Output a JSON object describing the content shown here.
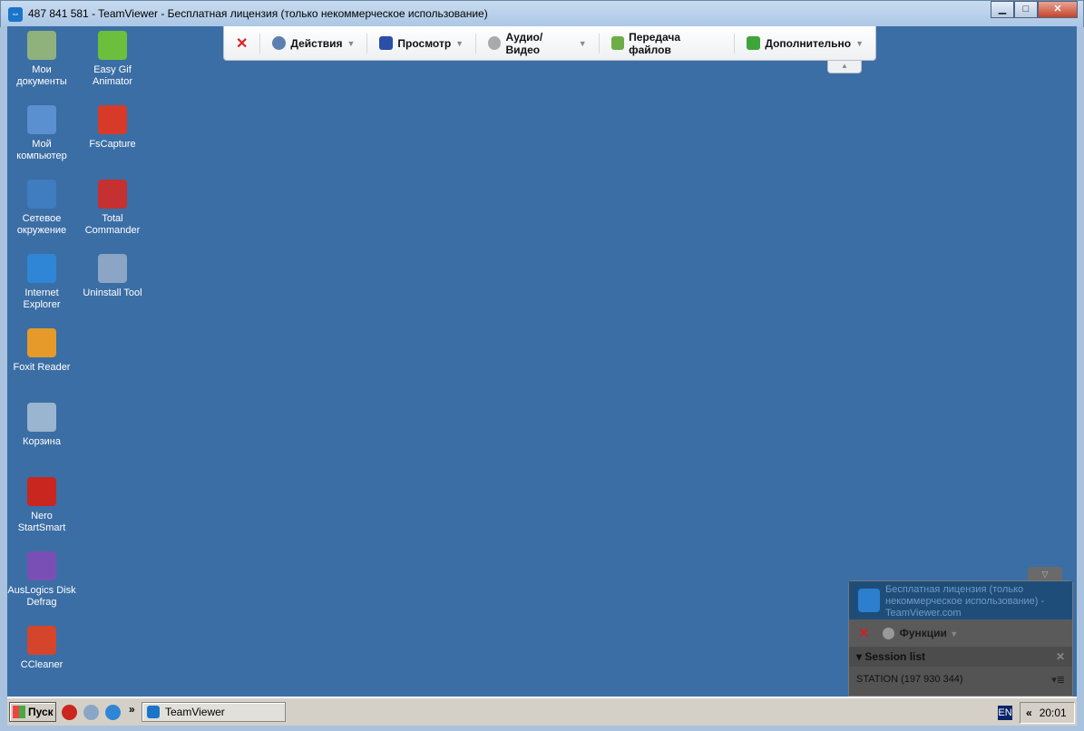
{
  "window": {
    "title": "487 841 581 - TeamViewer - Бесплатная лицензия (только некоммерческое использование)",
    "minimize": "▁",
    "maximize": "□",
    "close": "✕"
  },
  "toolbar": {
    "close_glyph": "✕",
    "items": [
      {
        "label": "Действия",
        "icon": "gear-icon"
      },
      {
        "label": "Просмотр",
        "icon": "monitor-icon"
      },
      {
        "label": "Аудио/Видео",
        "icon": "webcam-icon"
      },
      {
        "label": "Передача файлов",
        "icon": "file-transfer-icon"
      },
      {
        "label": "Дополнительно",
        "icon": "puzzle-icon"
      }
    ],
    "caret": "▼",
    "collapse": "▲"
  },
  "desktop_icons": [
    {
      "label": "Мои документы",
      "color": "#8fb27c"
    },
    {
      "label": "Easy Gif Animator",
      "color": "#6cbf3d"
    },
    {
      "label": "Мой компьютер",
      "color": "#5a8fd0"
    },
    {
      "label": "FsCapture",
      "color": "#d83a2a"
    },
    {
      "label": "Сетевое окружение",
      "color": "#3f7cc0"
    },
    {
      "label": "Total Commander",
      "color": "#c53030"
    },
    {
      "label": "Internet Explorer",
      "color": "#2f86d6"
    },
    {
      "label": "Uninstall Tool",
      "color": "#8aa6c4"
    },
    {
      "label": "Foxit Reader",
      "color": "#e59a2a"
    },
    {
      "label": "Корзина",
      "color": "#9ab5cf"
    },
    {
      "label": "Nero StartSmart",
      "color": "#c8261f"
    },
    {
      "label": "AusLogics Disk Defrag",
      "color": "#7a4fb5"
    },
    {
      "label": "CCleaner",
      "color": "#d4452b"
    }
  ],
  "panel": {
    "tab_glyph": "▽",
    "header": "Бесплатная лицензия (только некоммерческое использование) - TeamViewer.com",
    "functions": "Функции",
    "session_list": "Session list",
    "session_close": "✕",
    "session": "STATION (197 930 344)",
    "menu_glyph": "▾≣"
  },
  "taskbar": {
    "start": "Пуск",
    "more": "»",
    "task": "TeamViewer",
    "lang": "EN",
    "tray_expand": "«",
    "time": "20:01"
  }
}
